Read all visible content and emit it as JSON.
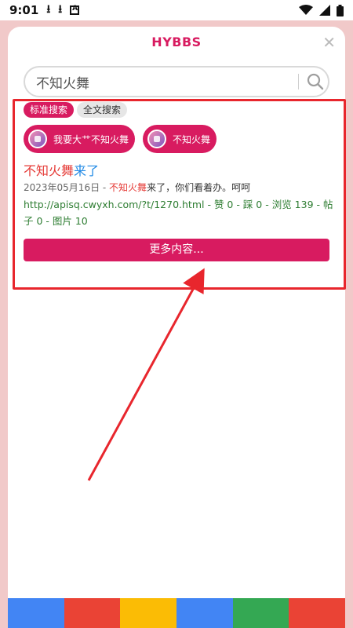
{
  "status_bar": {
    "time": "9:01",
    "icons": [
      "download-icon",
      "download-icon",
      "notification-a-icon",
      "wifi-icon",
      "signal-icon",
      "battery-icon"
    ]
  },
  "dialog": {
    "title": "HYBBS",
    "close_icon": "close-icon",
    "accent_color": "#d81b60"
  },
  "search": {
    "value": "不知火舞",
    "icon": "search-icon"
  },
  "tabs": [
    {
      "label": "标准搜索",
      "active": true
    },
    {
      "label": "全文搜索",
      "active": false
    }
  ],
  "chips": [
    {
      "label": "我要大艹不知火舞"
    },
    {
      "label": "不知火舞"
    }
  ],
  "result": {
    "title_highlight": "不知火舞",
    "title_rest": "来了",
    "date": "2023年05月16日 - ",
    "snippet_highlight": "不知火舞",
    "snippet_rest": "来了，你们看着办。呵呵",
    "link_line": "http://apisq.cwyxh.com/?t/1270.html - 赞 0 - 踩 0 - 浏览 139 - 帖子 0 - 图片 10"
  },
  "more_button": {
    "label": "更多内容..."
  },
  "color_bar": [
    "#4285f4",
    "#ea4335",
    "#fbbc05",
    "#4285f4",
    "#34a853",
    "#ea4335"
  ]
}
